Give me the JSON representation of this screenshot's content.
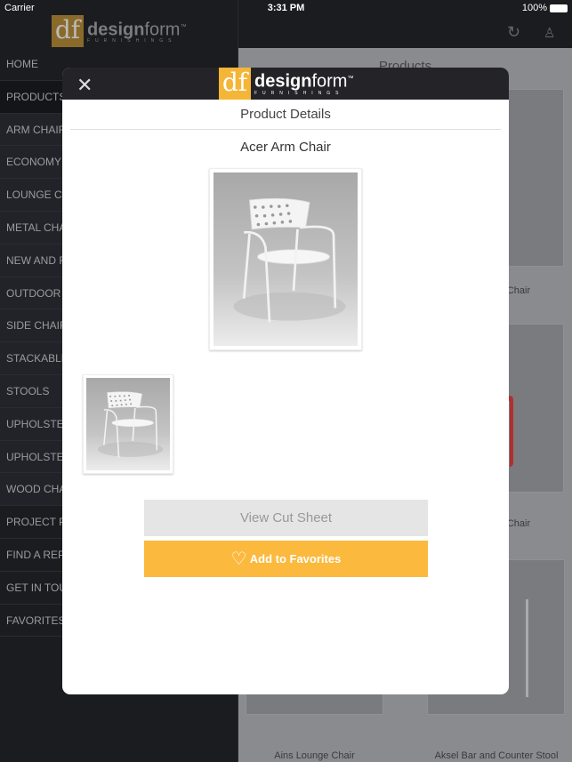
{
  "status": {
    "carrier": "Carrier",
    "time": "3:31 PM",
    "battery": "100%"
  },
  "brand": {
    "logo_mark": "df",
    "name_bold": "design",
    "name_light": "form",
    "tm": "™",
    "tagline": "FURNISHINGS"
  },
  "sidebar": {
    "items": [
      {
        "label": "HOME",
        "type": "top"
      },
      {
        "label": "PRODUCTS",
        "type": "dark"
      },
      {
        "label": "ARM CHAIR",
        "type": "sub"
      },
      {
        "label": "ECONOMY",
        "type": "sub"
      },
      {
        "label": "LOUNGE CH",
        "type": "sub"
      },
      {
        "label": "METAL CHA",
        "type": "sub"
      },
      {
        "label": "NEW AND F",
        "type": "sub"
      },
      {
        "label": "OUTDOOR C",
        "type": "sub"
      },
      {
        "label": "SIDE CHAIR",
        "type": "sub"
      },
      {
        "label": "STACKABLE",
        "type": "sub"
      },
      {
        "label": "STOOLS",
        "type": "sub"
      },
      {
        "label": "UPHOLSTE",
        "type": "sub"
      },
      {
        "label": "UPHOLSTE",
        "type": "sub"
      },
      {
        "label": "WOOD CHA",
        "type": "sub"
      },
      {
        "label": "PROJECT P",
        "type": "top"
      },
      {
        "label": "FIND A REP",
        "type": "top"
      },
      {
        "label": "GET IN TOU",
        "type": "top"
      },
      {
        "label": "FAVORITES",
        "type": "top"
      }
    ]
  },
  "topbar": {
    "icons": [
      "refresh-icon",
      "user-icon"
    ]
  },
  "products": {
    "title": "Products",
    "cards": [
      "Chair",
      "Chair",
      "Ains Lounge Chair",
      "Aksel Bar and Counter Stool"
    ]
  },
  "modal": {
    "title": "Product Details",
    "product_name": "Acer Arm Chair",
    "view_cut_sheet": "View Cut Sheet",
    "add_favorites": "Add to Favorites",
    "accent": "#fbb93d",
    "close_icon": "close-icon"
  }
}
